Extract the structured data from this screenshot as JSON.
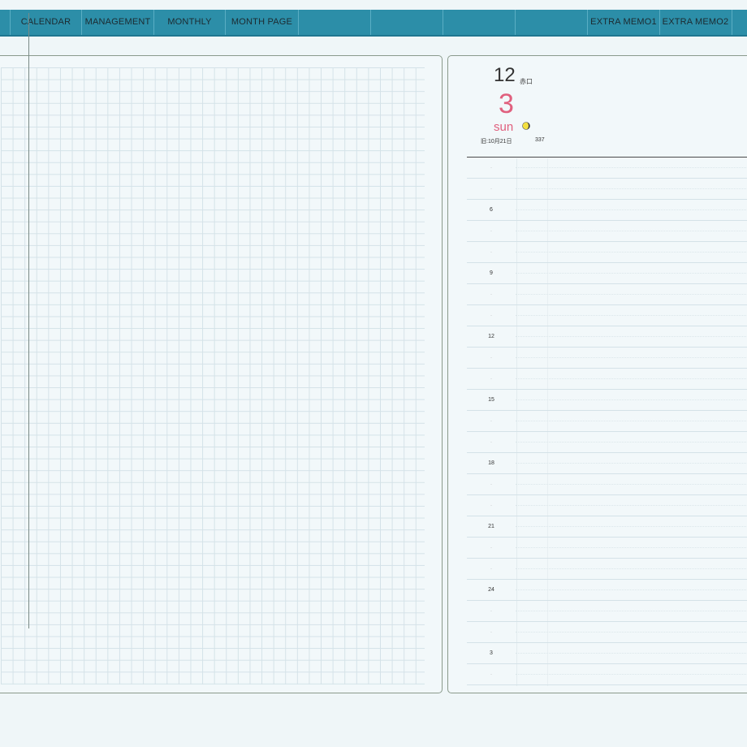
{
  "tabs": [
    {
      "label": ""
    },
    {
      "label": "CALENDAR"
    },
    {
      "label": "MANAGEMENT"
    },
    {
      "label": "MONTHLY"
    },
    {
      "label": "MONTH PAGE"
    },
    {
      "label": ""
    },
    {
      "label": ""
    },
    {
      "label": ""
    },
    {
      "label": "EXTRA MEMO1"
    },
    {
      "label": "EXTRA MEMO2"
    },
    {
      "label": ""
    }
  ],
  "day_page": {
    "month": "12",
    "month_kanji": "赤口",
    "day": "3",
    "weekday": "sun",
    "lunar_date": "旧:10月21日",
    "day_of_year": "337",
    "moon_icon": "moon-phase-icon",
    "hours": [
      "",
      "",
      "6",
      "",
      "",
      "9",
      "",
      "",
      "12",
      "",
      "",
      "15",
      "",
      "",
      "18",
      "",
      "",
      "21",
      "",
      "",
      "24",
      "",
      "",
      "3",
      ""
    ]
  },
  "colors": {
    "tab_bar": "#2c8ea8",
    "accent_pink": "#e0607e",
    "page_bg": "#eff6f8"
  }
}
